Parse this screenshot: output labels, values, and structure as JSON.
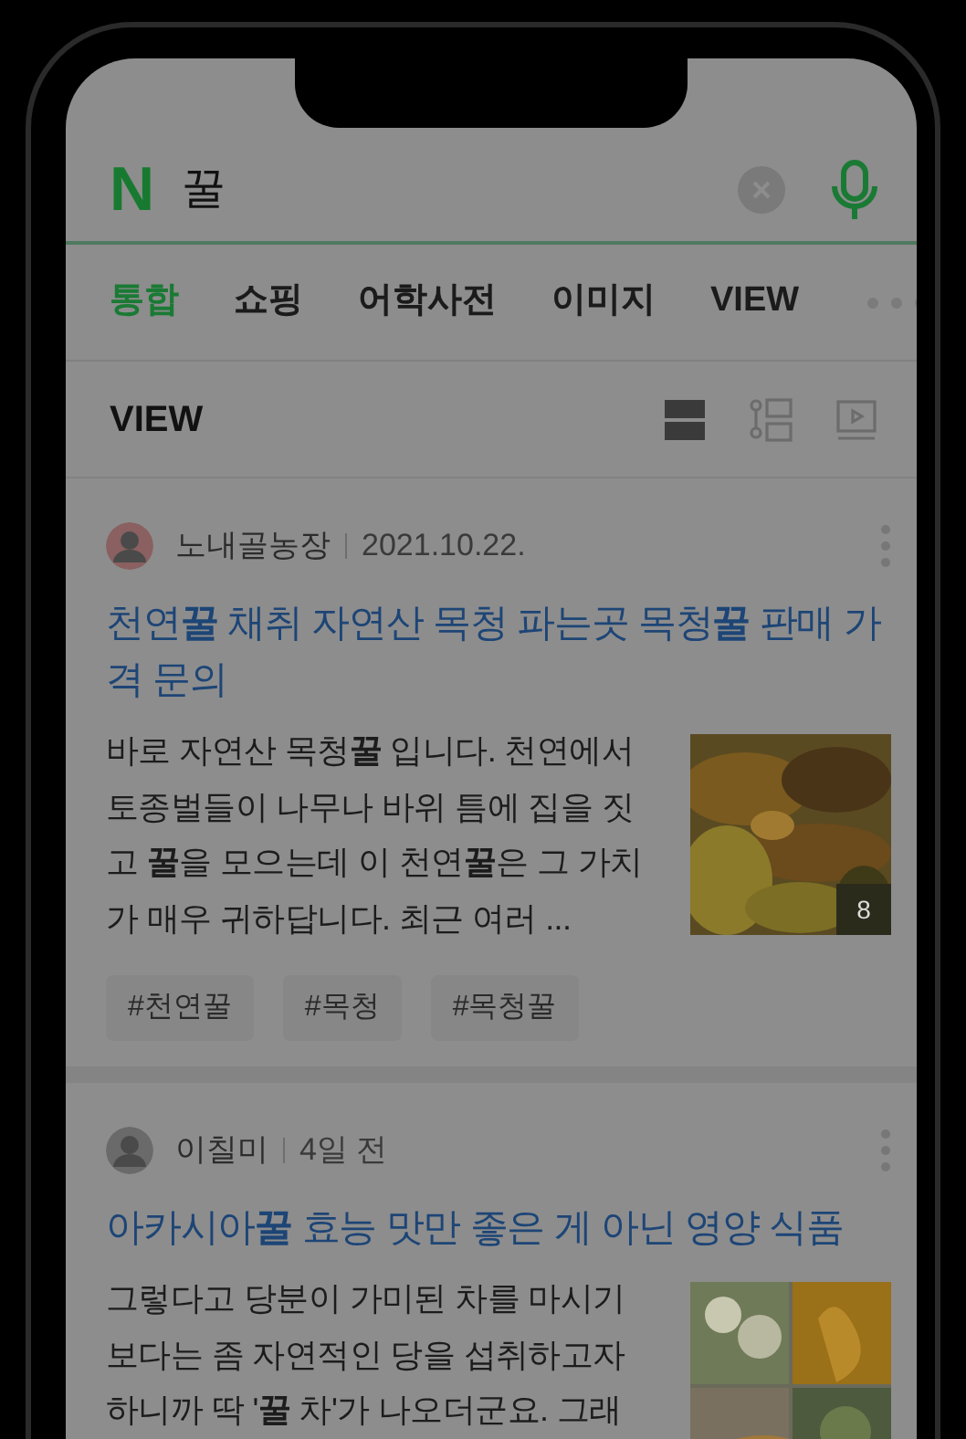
{
  "search": {
    "logo": "N",
    "query": "꿀"
  },
  "tabs": [
    {
      "label": "통합",
      "selected": true
    },
    {
      "label": "쇼핑",
      "selected": false
    },
    {
      "label": "어학사전",
      "selected": false
    },
    {
      "label": "이미지",
      "selected": false
    },
    {
      "label": "VIEW",
      "selected": false
    }
  ],
  "section": {
    "title": "VIEW",
    "view_modes": [
      {
        "kind": "list",
        "selected": true
      },
      {
        "kind": "feed",
        "selected": false
      },
      {
        "kind": "video",
        "selected": false
      }
    ]
  },
  "posts": [
    {
      "author": "노내골농장",
      "date": "2021.10.22.",
      "title": "천연**꿀** 채취 자연산 목청 파는곳 목청**꿀** 판매 가격 문의",
      "snippet": "바로 자연산 목청**꿀** 입니다. 천연에서 토종벌들이 나무나 바위 틈에 집을 짓고 **꿀**을 모으는데 이 천연**꿀**은 그 가치가 매우 귀하답니다. 최근 여러 ...",
      "image": {
        "kind": "picture",
        "count": "8"
      },
      "tags": [
        "#천연꿀",
        "#목청",
        "#목청꿀"
      ]
    },
    {
      "author": "이칠미",
      "date": "4일 전",
      "title": "아카시아**꿀** 효능 맛만 좋은 게 아닌 영양 식품",
      "snippet": "그렇다고 당분이 가미된 차를 마시기보다는 좀 자연적인 당을 섭취하고자 하니까 딱 '**꿀** 차'가 나오더군요. 그래"
    }
  ]
}
